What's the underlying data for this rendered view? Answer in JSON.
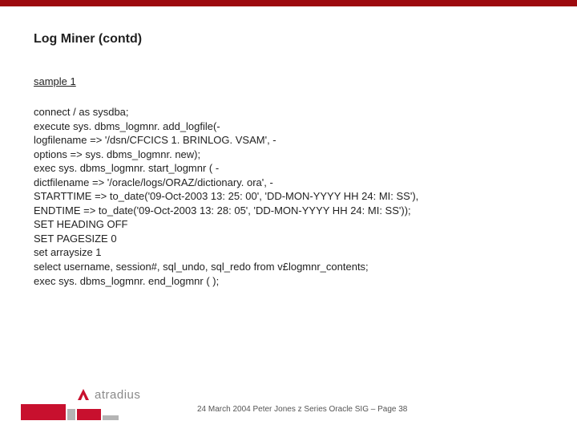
{
  "title": "Log Miner (contd)",
  "sample_label": "sample 1",
  "code_lines": [
    "connect / as sysdba;",
    "execute sys. dbms_logmnr. add_logfile(-",
    "logfilename => '/dsn/CFCICS 1. BRINLOG. VSAM', -",
    "options => sys. dbms_logmnr. new);",
    "exec sys. dbms_logmnr. start_logmnr ( -",
    "dictfilename => '/oracle/logs/ORAZ/dictionary. ora', -",
    "STARTTIME => to_date('09-Oct-2003 13: 25: 00', 'DD-MON-YYYY HH 24: MI: SS'),",
    "ENDTIME => to_date('09-Oct-2003 13: 28: 05', 'DD-MON-YYYY HH 24: MI: SS'));",
    "SET HEADING OFF",
    "SET PAGESIZE 0",
    "set arraysize 1",
    "select username, session#, sql_undo, sql_redo from v£logmnr_contents;",
    "exec sys. dbms_logmnr. end_logmnr ( );"
  ],
  "logo_text": "atradius",
  "footer": "24 March 2004 Peter Jones  z Series Oracle SIG  – Page 38",
  "colors": {
    "brand_red": "#9d0a0f",
    "logo_red": "#c8102e"
  }
}
